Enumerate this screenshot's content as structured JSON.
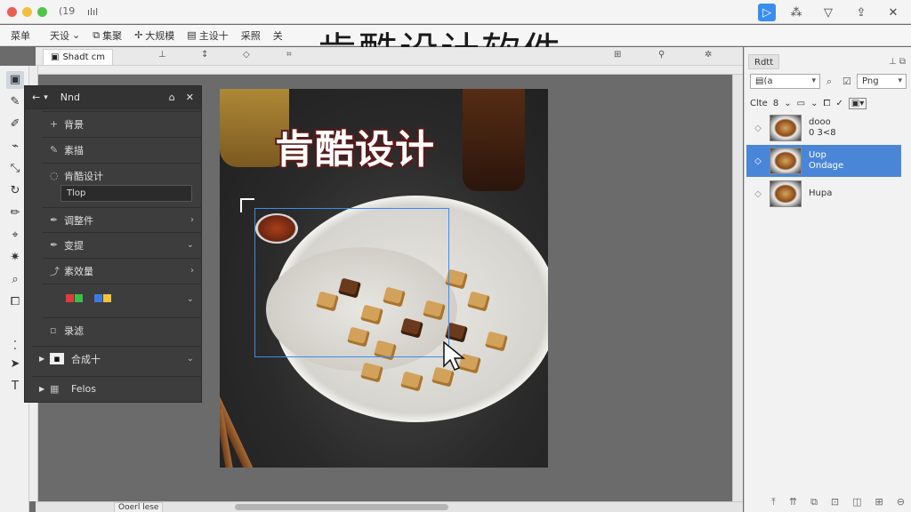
{
  "titlebar": {
    "count": "(19",
    "bars_icon": "bars-icon",
    "right_icons": [
      "cursor-select-icon",
      "grid-icon",
      "filter-icon",
      "export-icon",
      "close-icon"
    ]
  },
  "menubar": {
    "items": [
      "菜单",
      "天设",
      "集聚",
      "大规模",
      "主设十",
      "采照",
      "关"
    ]
  },
  "overlay_title": "肯酷设计软件",
  "doc_tab": {
    "label": "Shadt cm"
  },
  "floating_panel": {
    "title": "Nnd",
    "rows": [
      {
        "icon": "+",
        "label": "背景"
      },
      {
        "icon": "✎",
        "label": "素描"
      },
      {
        "icon": "◌",
        "label": "肯酷设计"
      },
      {
        "icon": "✒",
        "label": "调整件"
      },
      {
        "icon": "✒",
        "label": "变提"
      },
      {
        "icon": "⤴",
        "label": "素效量"
      },
      {
        "icon": "",
        "label": ""
      },
      {
        "icon": "▫",
        "label": "录滤"
      },
      {
        "icon": "▪",
        "label": "合成十"
      },
      {
        "icon": "▦",
        "label": "Felos"
      }
    ],
    "input_value": "Tlop"
  },
  "canvas": {
    "photo_title": "肯酷设计"
  },
  "right_panel": {
    "tab": "Rdtt",
    "select1": "(a",
    "select2": "Png",
    "options": [
      "Clte",
      "8"
    ],
    "layers": [
      {
        "name": "dooo",
        "sub": "0 3<8",
        "selected": false
      },
      {
        "name": "Uop",
        "sub": "Ondage",
        "selected": true
      },
      {
        "name": "Hupa",
        "sub": "",
        "selected": false
      }
    ]
  },
  "status": {
    "text": "Ooerl  lese"
  },
  "colors": {
    "accent": "#3a8df0",
    "selected_layer": "#4a86d8",
    "panel_dark": "#3d3d3d"
  }
}
